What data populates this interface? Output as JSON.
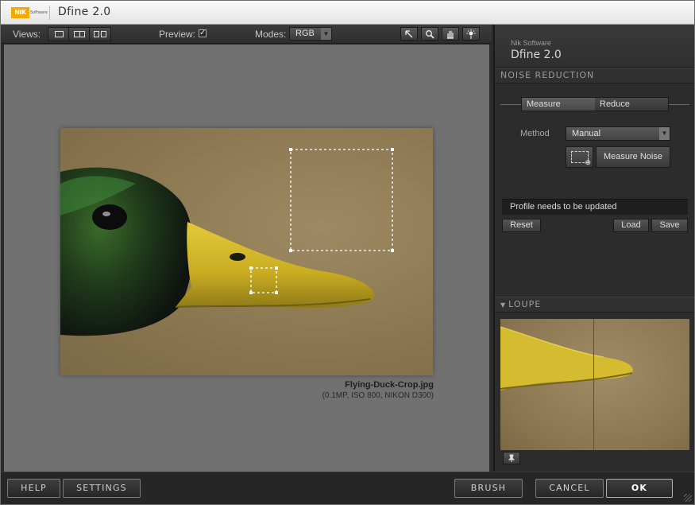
{
  "window": {
    "logo_text": "NIK",
    "logo_sub": "Software",
    "title": "Dfine 2.0"
  },
  "toolbar": {
    "views_label": "Views:",
    "preview_label": "Preview:",
    "preview_checked": true,
    "modes_label": "Modes:",
    "mode_value": "RGB",
    "tools": [
      "pointer-icon",
      "zoom-icon",
      "hand-icon",
      "light-icon"
    ]
  },
  "image": {
    "file_name": "Flying-Duck-Crop.jpg",
    "file_meta": "(0.1MP, ISO 800, NIKON D300)"
  },
  "panel": {
    "brand_small": "Nik Software",
    "brand_big": "Dfine 2.0",
    "section_noise": "NOISE REDUCTION",
    "tab_measure": "Measure",
    "tab_reduce": "Reduce",
    "method_label": "Method",
    "method_value": "Manual",
    "measure_noise": "Measure Noise",
    "status": "Profile needs to be updated",
    "reset": "Reset",
    "load": "Load",
    "save": "Save",
    "section_loupe": "LOUPE"
  },
  "bottom": {
    "help": "HELP",
    "settings": "SETTINGS",
    "brush": "BRUSH",
    "cancel": "CANCEL",
    "ok": "OK"
  }
}
